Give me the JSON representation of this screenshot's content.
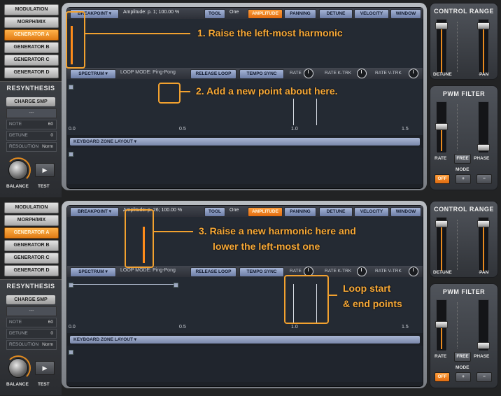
{
  "panels": [
    {
      "sidebar": {
        "buttons": [
          "MODULATION",
          "MORPH/MIX",
          "GENERATOR A",
          "GENERATOR B",
          "GENERATOR C",
          "GENERATOR D"
        ],
        "resynthesis_title": "RESYNTHESIS",
        "charge_label": "CHARGE SMP",
        "dash": "---",
        "note_label": "NOTE",
        "note_value": "60",
        "detune_label": "DETUNE",
        "detune_value": "0",
        "resolution_label": "RESOLUTION",
        "resolution_value": "Norm",
        "balance_label": "BALANCE",
        "test_label": "TEST"
      },
      "top_bar": {
        "breakpoint": "BREAKPOINT",
        "amplitude_text": "Amplitude: p. 1; 100.00 %",
        "tool": "TOOL",
        "one": "One",
        "amplitude": "AMPLITUDE",
        "panning": "PANNING",
        "detune": "DETUNE",
        "velocity": "VELOCITY",
        "window": "WINDOW"
      },
      "spectrum_bar": {
        "spectrum": "SPECTRUM",
        "loop_mode": "LOOP MODE: Ping-Pong",
        "release_loop": "RELEASE LOOP",
        "tempo_sync": "TEMPO SYNC",
        "rate": "RATE",
        "rate_ktrk": "RATE K-TRK",
        "rate_vtrk": "RATE V-TRK"
      },
      "ticks": [
        "0.0",
        "0.5",
        "1.0",
        "1.5"
      ],
      "keyboard_zone": "KEYBOARD ZONE LAYOUT",
      "control_range": {
        "title": "CONTROL RANGE",
        "detune": "DETUNE",
        "pan": "PAN"
      },
      "pwm_filter": {
        "title": "PWM FILTER",
        "rate": "RATE",
        "free": "FREE",
        "phase": "PHASE",
        "mode": "MODE",
        "off": "OFF",
        "plus": "+",
        "minus": "−"
      },
      "annotations": {
        "a1": "1. Raise the left-most harmonic",
        "a2": "2. Add a new point about here."
      }
    },
    {
      "sidebar": {
        "buttons": [
          "MODULATION",
          "MORPH/MIX",
          "GENERATOR A",
          "GENERATOR B",
          "GENERATOR C",
          "GENERATOR D"
        ],
        "resynthesis_title": "RESYNTHESIS",
        "charge_label": "CHARGE SMP",
        "dash": "---",
        "note_label": "NOTE",
        "note_value": "60",
        "detune_label": "DETUNE",
        "detune_value": "0",
        "resolution_label": "RESOLUTION",
        "resolution_value": "Norm",
        "balance_label": "BALANCE",
        "test_label": "TEST"
      },
      "top_bar": {
        "breakpoint": "BREAKPOINT",
        "amplitude_text": "Amplitude: p. 26; 100.00 %",
        "tool": "TOOL",
        "one": "One",
        "amplitude": "AMPLITUDE",
        "panning": "PANNING",
        "detune": "DETUNE",
        "velocity": "VELOCITY",
        "window": "WINDOW"
      },
      "spectrum_bar": {
        "spectrum": "SPECTRUM",
        "loop_mode": "LOOP MODE: Ping-Pong",
        "release_loop": "RELEASE LOOP",
        "tempo_sync": "TEMPO SYNC",
        "rate": "RATE",
        "rate_ktrk": "RATE K-TRK",
        "rate_vtrk": "RATE V-TRK"
      },
      "ticks": [
        "0.0",
        "0.5",
        "1.0",
        "1.5"
      ],
      "keyboard_zone": "KEYBOARD ZONE LAYOUT",
      "control_range": {
        "title": "CONTROL RANGE",
        "detune": "DETUNE",
        "pan": "PAN"
      },
      "pwm_filter": {
        "title": "PWM FILTER",
        "rate": "RATE",
        "free": "FREE",
        "phase": "PHASE",
        "mode": "MODE",
        "off": "OFF",
        "plus": "+",
        "minus": "−"
      },
      "annotations": {
        "a3_line1": "3. Raise a new harmonic here and",
        "a3_line2": "lower the left-most one",
        "a4_line1": "Loop start",
        "a4_line2": "& end points"
      }
    }
  ],
  "colors": {
    "accent": "#f2a12f",
    "active": "#f08a1c",
    "blue_button": "#8c9cc4"
  }
}
